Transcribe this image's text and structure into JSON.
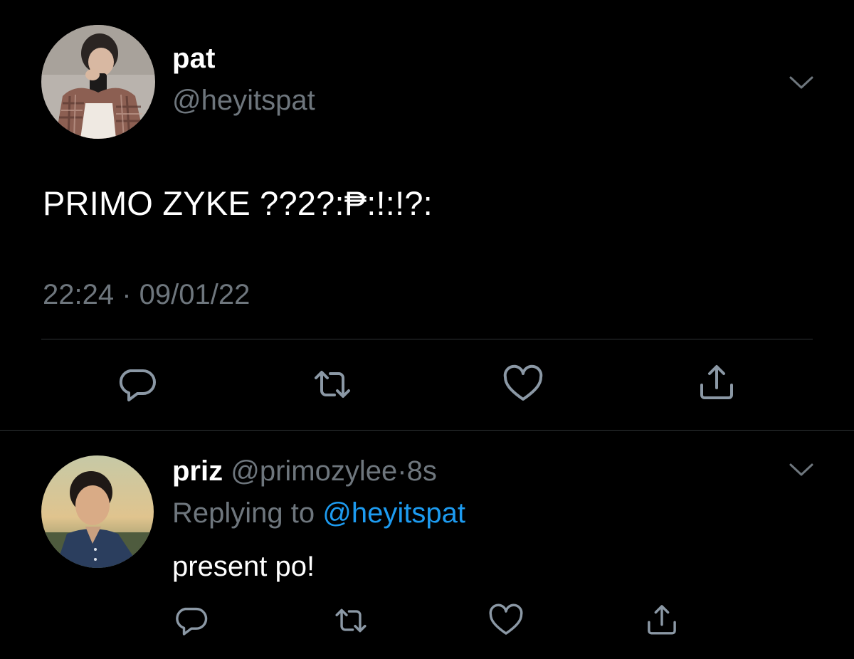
{
  "main_tweet": {
    "display_name": "pat",
    "handle": "@heyitspat",
    "text": "PRIMO ZYKE ??2?:₱:!:!?:",
    "timestamp": "22:24 · 09/01/22",
    "icons": {
      "avatar": "profile-photo",
      "menu": "chevron-down-icon",
      "reply": "comment-icon",
      "retweet": "retweet-icon",
      "like": "heart-icon",
      "share": "share-icon"
    }
  },
  "reply_tweet": {
    "display_name": "priz",
    "handle": "@primozylee",
    "separator": "·",
    "time_ago": "8s",
    "replying_prefix": "Replying to",
    "replying_mention": "@heyitspat",
    "text": "present po!",
    "icons": {
      "avatar": "profile-photo",
      "menu": "chevron-down-icon",
      "reply": "comment-icon",
      "retweet": "retweet-icon",
      "like": "heart-icon",
      "share": "share-icon"
    }
  },
  "colors": {
    "background": "#000000",
    "primary_text": "#ffffff",
    "secondary_text": "#6e767d",
    "link": "#1d9bf0",
    "divider": "#2f3336"
  }
}
